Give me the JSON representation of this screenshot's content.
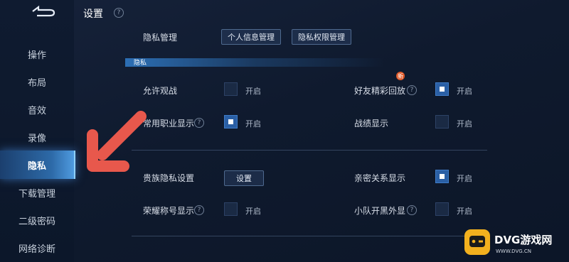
{
  "header": {
    "title": "设置"
  },
  "sidebar": {
    "items": [
      {
        "label": "操作"
      },
      {
        "label": "布局"
      },
      {
        "label": "音效"
      },
      {
        "label": "录像"
      },
      {
        "label": "隐私"
      },
      {
        "label": "下载管理"
      },
      {
        "label": "二级密码"
      },
      {
        "label": "网络诊断"
      }
    ],
    "active": "隐私"
  },
  "privacy_management": {
    "label": "隐私管理",
    "buttons": [
      "个人信息管理",
      "隐私权限管理"
    ]
  },
  "section": {
    "label": "隐私"
  },
  "settings": {
    "allow_spectate": {
      "label": "允许观战",
      "state_label": "开启",
      "checked": false
    },
    "friend_highlight": {
      "label": "好友精彩回放",
      "state_label": "开启",
      "checked": true,
      "badge": "新"
    },
    "common_job": {
      "label": "常用职业显示",
      "state_label": "开启",
      "checked": true
    },
    "record_display": {
      "label": "战绩显示",
      "state_label": "开启",
      "checked": false
    },
    "noble_privacy": {
      "label": "贵族隐私设置",
      "button_label": "设置"
    },
    "intimate_display": {
      "label": "亲密关系显示",
      "state_label": "开启",
      "checked": true
    },
    "honor_title": {
      "label": "荣耀称号显示",
      "state_label": "开启",
      "checked": false
    },
    "squad_black": {
      "label": "小队开黑外显",
      "state_label": "开启",
      "checked": false
    }
  },
  "icons": {
    "back": "back-arrow-icon",
    "help": "question-mark-icon",
    "annotation_arrow": "red-arrow-icon"
  },
  "colors": {
    "accent": "#2a5fa5",
    "annotation": "#e8584c",
    "badge": "#e05a2a",
    "watermark": "#f2b01e"
  },
  "watermark": {
    "brand": "DVG游戏网",
    "url": "WWW.DVG.CN"
  }
}
